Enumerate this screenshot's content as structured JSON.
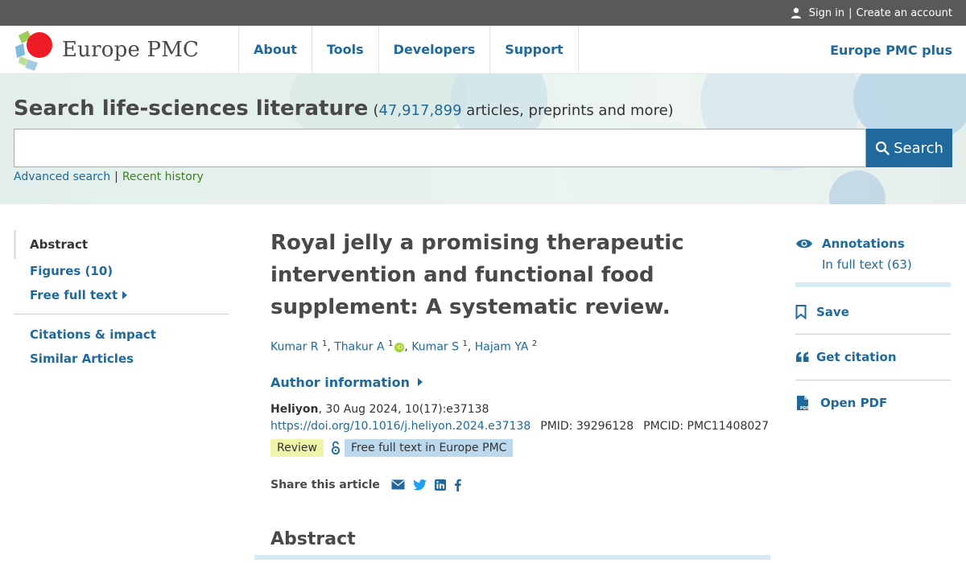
{
  "topbar": {
    "sign_in": "Sign in",
    "separator": "|",
    "create_account": "Create an account"
  },
  "header": {
    "logo_text": "Europe PMC",
    "nav": [
      "About",
      "Tools",
      "Developers",
      "Support"
    ],
    "plus_link": "Europe PMC plus"
  },
  "search": {
    "heading": "Search life-sciences literature",
    "count_open": "(",
    "count_number": "47,917,899",
    "count_rest": " articles, preprints and more)",
    "input_value": "",
    "button_label": "Search",
    "advanced_link": "Advanced search",
    "pipe": "|",
    "history_link": "Recent history"
  },
  "leftnav": {
    "items": [
      "Abstract",
      "Figures (10)",
      "Free full text",
      "Citations & impact",
      "Similar Articles"
    ]
  },
  "article": {
    "title": "Royal jelly a promising therapeutic intervention and functional food supplement: A systematic review.",
    "authors": [
      {
        "name": "Kumar R",
        "aff": "1"
      },
      {
        "name": "Thakur A",
        "aff": "1"
      },
      {
        "name": "Kumar S",
        "aff": "1"
      },
      {
        "name": "Hajam YA",
        "aff": "2"
      }
    ],
    "orcid_label": "iD",
    "author_info": "Author information",
    "journal": "Heliyon",
    "citation_rest": ", 30 Aug 2024, 10(17):e37138",
    "doi": "https://doi.org/10.1016/j.heliyon.2024.e37138",
    "pmid": "PMID: 39296128",
    "pmcid": "PMCID: PMC11408027",
    "badge_review": "Review",
    "badge_free": "Free full text in Europe PMC",
    "share_label": "Share this article",
    "abstract_heading": "Abstract"
  },
  "right_panel": {
    "annotations": "Annotations",
    "in_full_text": "In full text (63)",
    "save": "Save",
    "get_citation": "Get citation",
    "open_pdf": "Open PDF"
  },
  "colors": {
    "link": "#20699c",
    "topbar": "#595959",
    "review_badge": "#eef5a8",
    "free_badge": "#bcd8ec",
    "history_link": "#3d7f1f"
  },
  "icons": [
    "person-icon",
    "search-icon",
    "orcid-icon",
    "open-access-icon",
    "email-icon",
    "twitter-icon",
    "linkedin-icon",
    "facebook-icon",
    "eye-icon",
    "bookmark-icon",
    "quote-icon",
    "pdf-icon"
  ]
}
